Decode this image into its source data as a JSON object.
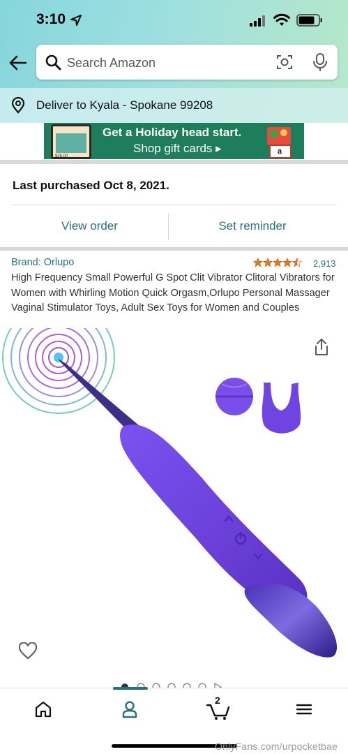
{
  "status_bar": {
    "time": "3:10"
  },
  "header": {
    "search": {
      "placeholder": "Search Amazon"
    },
    "deliver_to": "Deliver to Kyala - Spokane 99208"
  },
  "banner": {
    "line1": "Get a Holiday head start.",
    "line2": "Shop gift cards ▸",
    "phone_text": "$25.00",
    "card_letter": "a"
  },
  "order": {
    "last_purchased": "Last purchased Oct 8, 2021.",
    "view_order_label": "View order",
    "set_reminder_label": "Set reminder"
  },
  "product": {
    "brand": "Brand: Orlupo",
    "rating_stars": 4.5,
    "rating_count": "2,913",
    "title": "High Frequency Small Powerful G Spot Clit Vibrator Clitoral Vibrators for Women with Whirling Motion Quick Orgasm,Orlupo Personal Massager Vaginal Stimulator Toys, Adult Sex Toys for Women and Couples",
    "image_count": 7,
    "active_image": 1
  },
  "bottom_nav": {
    "items": [
      "home-icon",
      "account-icon",
      "cart-icon",
      "menu-icon"
    ],
    "active": "account-icon",
    "cart_count": "2"
  },
  "watermark": "OnlyFans.com/urpocketbae",
  "colors": {
    "link": "#2a6f83",
    "star": "#de7921",
    "product": "#6a3fd8"
  }
}
